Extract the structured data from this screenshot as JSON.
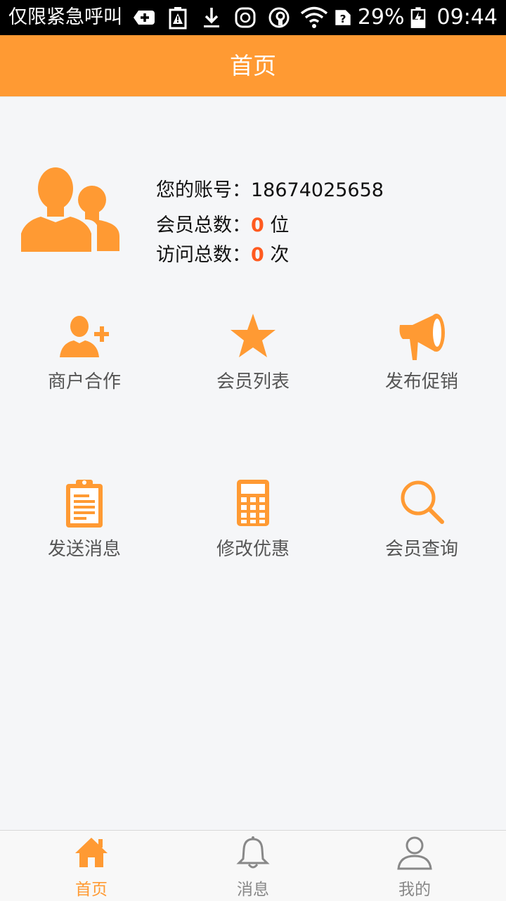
{
  "status_bar": {
    "carrier_text": "仅限紧急呼叫",
    "battery_percent": "29%",
    "time": "09:44"
  },
  "header": {
    "title": "首页"
  },
  "profile": {
    "account_label": "您的账号：",
    "account_value": "18674025658",
    "members_label": "会员总数：",
    "members_count": "0",
    "members_unit": "位",
    "visits_label": "访问总数：",
    "visits_count": "0",
    "visits_unit": "次"
  },
  "grid": [
    {
      "label": "商户合作",
      "icon": "add-user-icon"
    },
    {
      "label": "会员列表",
      "icon": "star-icon"
    },
    {
      "label": "发布促销",
      "icon": "megaphone-icon"
    },
    {
      "label": "发送消息",
      "icon": "clipboard-icon"
    },
    {
      "label": "修改优惠",
      "icon": "calculator-icon"
    },
    {
      "label": "会员查询",
      "icon": "search-icon"
    }
  ],
  "tabs": [
    {
      "label": "首页",
      "icon": "home-icon",
      "active": true
    },
    {
      "label": "消息",
      "icon": "bell-icon",
      "active": false
    },
    {
      "label": "我的",
      "icon": "user-icon",
      "active": false
    }
  ],
  "colors": {
    "accent": "#ff9a33",
    "highlight_number": "#ff5a1f",
    "background": "#f5f6f8"
  }
}
